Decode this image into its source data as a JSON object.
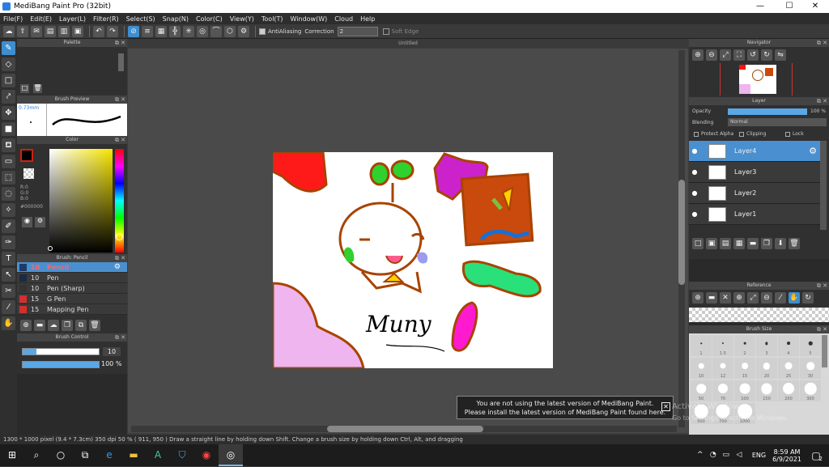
{
  "window": {
    "title": "MediBang Paint Pro (32bit)",
    "minimize": "—",
    "maximize": "☐",
    "close": "✕"
  },
  "menu": [
    "File(F)",
    "Edit(E)",
    "Layer(L)",
    "Filter(R)",
    "Select(S)",
    "Snap(N)",
    "Color(C)",
    "View(Y)",
    "Tool(T)",
    "Window(W)",
    "Cloud",
    "Help"
  ],
  "toolbar": {
    "antialiasing_label": "AntiAliasing",
    "correction_label": "Correction",
    "correction_value": "2",
    "soft_edge_label": "Soft Edge"
  },
  "panels": {
    "palette": "Palette",
    "brush_preview": "Brush Preview",
    "brush_preview_size": "0.73mm",
    "color": "Color",
    "color_values": {
      "r": "R:0",
      "g": "G:0",
      "b": "B:0",
      "hex": "#000000"
    },
    "brush": "Brush: Pencil",
    "brush_control": "Brush Control",
    "brush_control_size": "10",
    "brush_control_opacity": "100 %",
    "navigator": "Navigator",
    "layer": "Layer",
    "reference": "Reference",
    "brush_size": "Brush Size",
    "canvas_title": "Untitled"
  },
  "brushes": [
    {
      "size": "10",
      "name": "Pencil",
      "color": "#1a3b6b"
    },
    {
      "size": "10",
      "name": "Pen",
      "color": "#1a2b44"
    },
    {
      "size": "10",
      "name": "Pen (Sharp)",
      "color": "#333"
    },
    {
      "size": "15",
      "name": "G Pen",
      "color": "#d32f2f"
    },
    {
      "size": "15",
      "name": "Mapping Pen",
      "color": "#d32f2f"
    }
  ],
  "layer_panel": {
    "opacity_label": "Opacity",
    "opacity_value": "100 %",
    "blending_label": "Blending",
    "blending_value": "Normal",
    "protect_alpha": "Protect Alpha",
    "clipping": "Clipping",
    "lock": "Lock"
  },
  "layers": [
    {
      "name": "Layer4",
      "selected": true
    },
    {
      "name": "Layer3",
      "selected": false
    },
    {
      "name": "Layer2",
      "selected": false
    },
    {
      "name": "Layer1",
      "selected": false
    }
  ],
  "brush_sizes": [
    "1",
    "1.5",
    "2",
    "3",
    "4",
    "5",
    "10",
    "12",
    "15",
    "20",
    "25",
    "30",
    "50",
    "70",
    "100",
    "150",
    "200",
    "300",
    "500",
    "700",
    "1000"
  ],
  "canvas_signature": "Muny",
  "status": "1300 * 1000 pixel  (9.4 * 7.3cm)  350 dpi  50 %  ( 911, 950 )  Draw a straight line by holding down Shift. Change a brush size by holding down Ctrl, Alt, and dragging",
  "notification": {
    "line1": "You are not using the latest version of MediBang Paint.",
    "line2": "Please install the latest version of MediBang Paint found here.",
    "close": "✕"
  },
  "watermark": {
    "line1": "Activate Windows",
    "line2": "Go to Settings to activate Windows."
  },
  "taskbar": {
    "language": "ENG",
    "time": "8:59 AM",
    "date": "6/9/2021",
    "notifications": "2"
  }
}
